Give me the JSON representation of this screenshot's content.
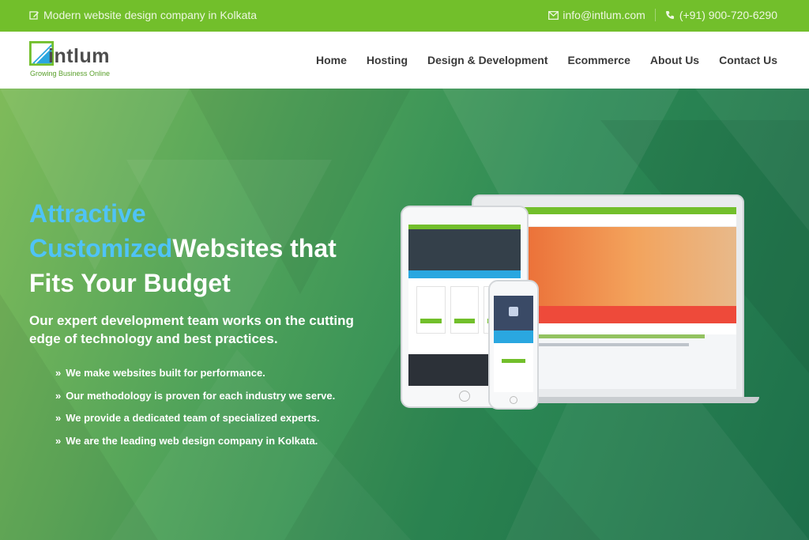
{
  "topbar": {
    "tagline": "Modern website design company in Kolkata",
    "email": "info@intlum.com",
    "phone": "(+91) 900-720-6290",
    "tagline_icon": "edit-icon",
    "email_icon": "envelope-icon",
    "phone_icon": "phone-icon"
  },
  "header": {
    "logo": {
      "name": "intlum",
      "tagline": "Growing Business Online"
    },
    "nav": [
      {
        "label": "Home"
      },
      {
        "label": "Hosting"
      },
      {
        "label": "Design & Development"
      },
      {
        "label": "Ecommerce"
      },
      {
        "label": "About Us"
      },
      {
        "label": "Contact Us"
      }
    ]
  },
  "hero": {
    "headline": {
      "line1": "Attractive",
      "line2_highlight": "Customized",
      "line2_rest": "Websites that",
      "line3": "Fits Your Budget"
    },
    "subheading": "Our expert development team works on the cutting edge of technology and best practices.",
    "bullets": [
      "We make websites built for performance.",
      "Our methodology is proven for each industry we serve.",
      "We provide a dedicated team of specialized experts.",
      "We are the leading web design company in Kolkata."
    ],
    "bullet_icon": "double-chevron-right-icon"
  },
  "colors": {
    "topbar": "#72bf2b",
    "header_bg": "#ffffff",
    "nav_text": "#3a3a3a",
    "highlight": "#4fc3f7",
    "hero_text": "#ffffff"
  }
}
